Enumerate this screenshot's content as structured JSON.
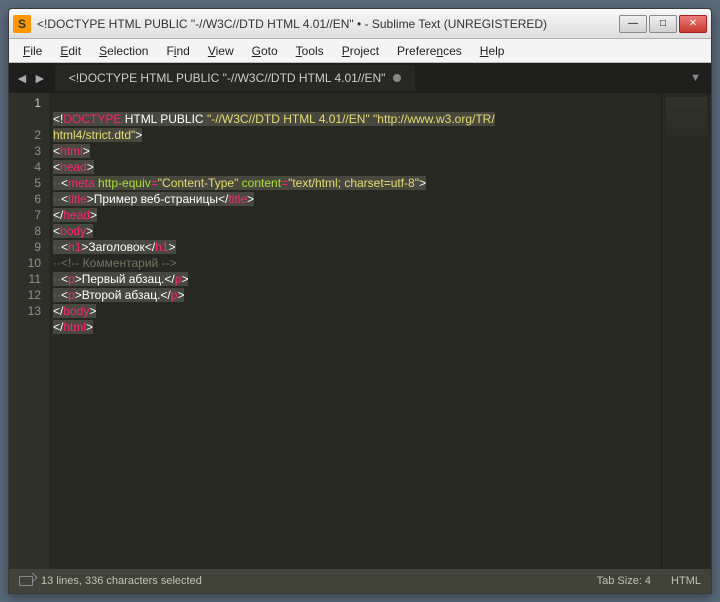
{
  "title": "<!DOCTYPE HTML PUBLIC \"-//W3C//DTD HTML 4.01//EN\" • - Sublime Text (UNREGISTERED)",
  "menu": {
    "file": "File",
    "edit": "Edit",
    "selection": "Selection",
    "find": "Find",
    "view": "View",
    "goto": "Goto",
    "tools": "Tools",
    "project": "Project",
    "preferences": "Preferences",
    "help": "Help"
  },
  "tab": {
    "label": "<!DOCTYPE HTML PUBLIC \"-//W3C//DTD HTML 4.01//EN\""
  },
  "gutter": [
    "1",
    "2",
    "3",
    "4",
    "5",
    "6",
    "7",
    "8",
    "9",
    "10",
    "11",
    "12",
    "13"
  ],
  "code": {
    "l1a": "<!",
    "l1b": "DOCTYPE",
    "l1c": " HTML PUBLIC ",
    "l1d": "\"-//W3C//DTD HTML 4.01//EN\"",
    "l1e": " ",
    "l1f": "\"http://www.w3.org/TR/",
    "l1g": "html4/strict.dtd\"",
    "l1h": ">",
    "l2a": "<",
    "l2b": "html",
    "l2c": ">",
    "l3a": "<",
    "l3b": "head",
    "l3c": ">",
    "l4sp": "··",
    "l4a": "<",
    "l4b": "meta",
    "l4c": " ",
    "l4d": "http-equiv",
    "l4e": "=",
    "l4f": "\"Content-Type\"",
    "l4g": " ",
    "l4h": "content",
    "l4i": "=",
    "l4j": "\"text/html; charset=utf-8\"",
    "l4k": ">",
    "l5sp": "··",
    "l5a": "<",
    "l5b": "title",
    "l5c": ">",
    "l5d": "Пример веб-страницы",
    "l5e": "</",
    "l5f": "title",
    "l5g": ">",
    "l6a": "</",
    "l6b": "head",
    "l6c": ">",
    "l7a": "<",
    "l7b": "body",
    "l7c": ">",
    "l8sp": "··",
    "l8a": "<",
    "l8b": "h1",
    "l8c": ">",
    "l8d": "Заголовок",
    "l8e": "</",
    "l8f": "h1",
    "l8g": ">",
    "l9sp": "··",
    "l9a": "<!-- Комментарий -->",
    "l10sp": "··",
    "l10a": "<",
    "l10b": "p",
    "l10c": ">",
    "l10d": "Первый абзац.",
    "l10e": "</",
    "l10f": "p",
    "l10g": ">",
    "l11sp": "··",
    "l11a": "<",
    "l11b": "p",
    "l11c": ">",
    "l11d": "Второй абзац.",
    "l11e": "</",
    "l11f": "p",
    "l11g": ">",
    "l12a": "</",
    "l12b": "body",
    "l12c": ">",
    "l13a": "</",
    "l13b": "html",
    "l13c": ">"
  },
  "status": {
    "info": "13 lines, 336 characters selected",
    "tabsize": "Tab Size: 4",
    "syntax": "HTML"
  }
}
